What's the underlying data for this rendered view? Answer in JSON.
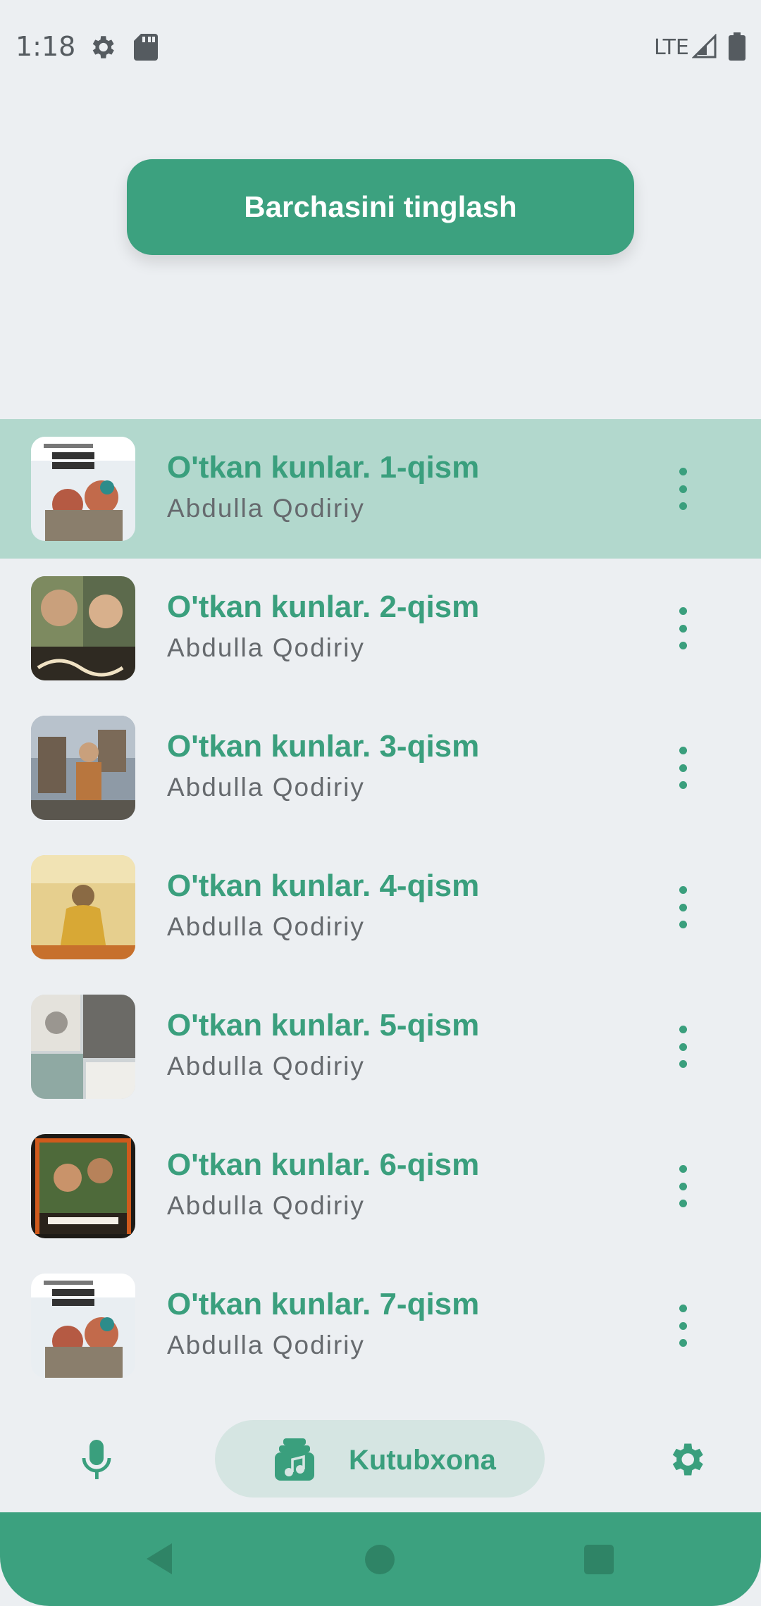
{
  "status_bar": {
    "time": "1:18",
    "network": "LTE"
  },
  "play_all_label": "Barchasini tinglash",
  "tracks": [
    {
      "title": "O'tkan kunlar. 1-qism",
      "author": "Abdulla Qodiriy",
      "active": true
    },
    {
      "title": "O'tkan kunlar. 2-qism",
      "author": "Abdulla Qodiriy",
      "active": false
    },
    {
      "title": "O'tkan kunlar. 3-qism",
      "author": "Abdulla Qodiriy",
      "active": false
    },
    {
      "title": "O'tkan kunlar. 4-qism",
      "author": "Abdulla Qodiriy",
      "active": false
    },
    {
      "title": "O'tkan kunlar. 5-qism",
      "author": "Abdulla Qodiriy",
      "active": false
    },
    {
      "title": "O'tkan kunlar. 6-qism",
      "author": "Abdulla Qodiriy",
      "active": false
    },
    {
      "title": "O'tkan kunlar. 7-qism",
      "author": "Abdulla Qodiriy",
      "active": false
    }
  ],
  "bottom_nav": {
    "library_label": "Kutubxona"
  },
  "colors": {
    "accent": "#3ca17f",
    "active_row": "#b2d8cd",
    "background": "#eceff2"
  }
}
